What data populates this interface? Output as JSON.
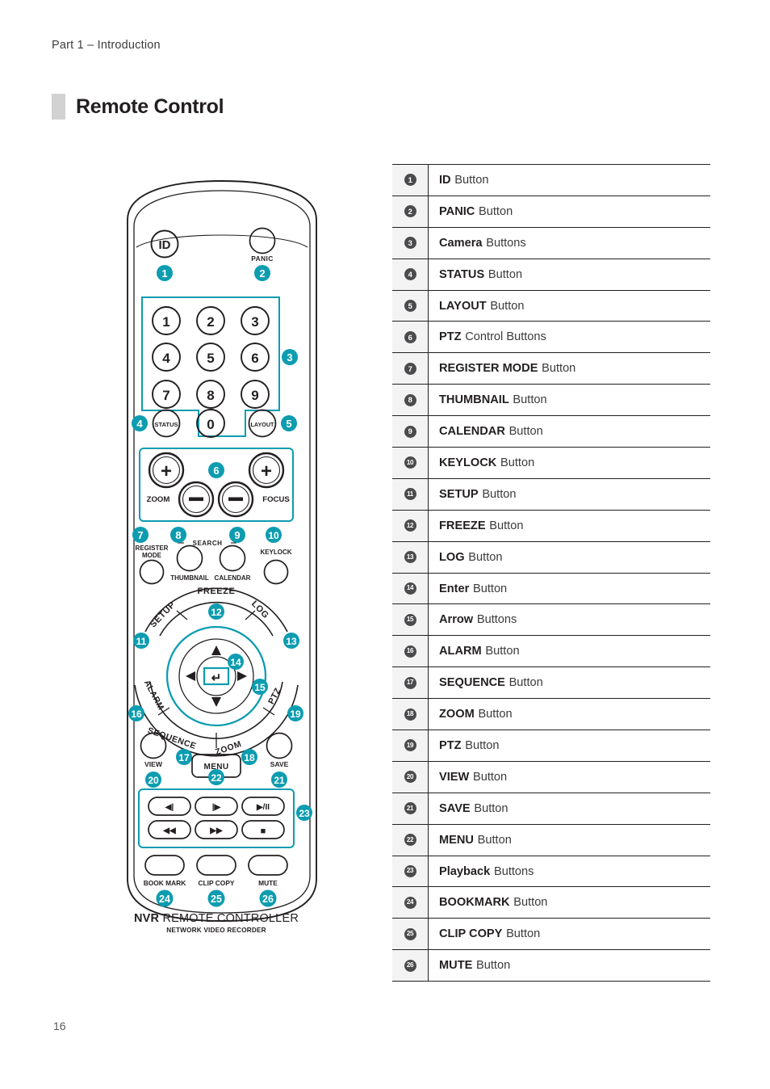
{
  "page": {
    "running_head": "Part 1 – Introduction",
    "section_title": "Remote Control",
    "page_number": "16"
  },
  "colors": {
    "accent_teal": "#0d9cb0",
    "badge_dark": "#4b4b4d",
    "marker_gray": "#d2d2d2",
    "row_num_bg": "#f3f3f3",
    "ink": "#231f20"
  },
  "reference_table": {
    "rows": [
      {
        "num": "1",
        "glyph": "❶",
        "bold": "ID",
        "rest": "Button"
      },
      {
        "num": "2",
        "glyph": "❷",
        "bold": "PANIC",
        "rest": "Button"
      },
      {
        "num": "3",
        "glyph": "❸",
        "bold": "Camera",
        "rest": "Buttons"
      },
      {
        "num": "4",
        "glyph": "❹",
        "bold": "STATUS",
        "rest": "Button"
      },
      {
        "num": "5",
        "glyph": "❺",
        "bold": "LAYOUT",
        "rest": "Button"
      },
      {
        "num": "6",
        "glyph": "❻",
        "bold": "PTZ",
        "rest": "Control Buttons"
      },
      {
        "num": "7",
        "glyph": "❼",
        "bold": "REGISTER MODE",
        "rest": "Button"
      },
      {
        "num": "8",
        "glyph": "❽",
        "bold": "THUMBNAIL",
        "rest": "Button"
      },
      {
        "num": "9",
        "glyph": "❾",
        "bold": "CALENDAR",
        "rest": "Button"
      },
      {
        "num": "10",
        "glyph": "❿",
        "bold": "KEYLOCK",
        "rest": "Button"
      },
      {
        "num": "11",
        "glyph": "⓫",
        "bold": "SETUP",
        "rest": "Button"
      },
      {
        "num": "12",
        "glyph": "⓬",
        "bold": "FREEZE",
        "rest": "Button"
      },
      {
        "num": "13",
        "glyph": "⓭",
        "bold": "LOG",
        "rest": "Button"
      },
      {
        "num": "14",
        "glyph": "⓮",
        "bold": "Enter",
        "rest": "Button"
      },
      {
        "num": "15",
        "glyph": "⓯",
        "bold": "Arrow",
        "rest": "Buttons"
      },
      {
        "num": "16",
        "glyph": "⓰",
        "bold": "ALARM",
        "rest": "Button"
      },
      {
        "num": "17",
        "glyph": "⓱",
        "bold": "SEQUENCE",
        "rest": "Button"
      },
      {
        "num": "18",
        "glyph": "⓲",
        "bold": "ZOOM",
        "rest": "Button"
      },
      {
        "num": "19",
        "glyph": "⓳",
        "bold": "PTZ",
        "rest": "Button"
      },
      {
        "num": "20",
        "glyph": "⓴",
        "bold": "VIEW",
        "rest": "Button"
      },
      {
        "num": "21",
        "glyph": "㉑",
        "bold": "SAVE",
        "rest": "Button"
      },
      {
        "num": "22",
        "glyph": "㉒",
        "bold": "MENU",
        "rest": "Button"
      },
      {
        "num": "23",
        "glyph": "㉓",
        "bold": "Playback",
        "rest": "Buttons"
      },
      {
        "num": "24",
        "glyph": "㉔",
        "bold": "BOOKMARK",
        "rest": "Button"
      },
      {
        "num": "25",
        "glyph": "㉕",
        "bold": "CLIP COPY",
        "rest": "Button"
      },
      {
        "num": "26",
        "glyph": "㉖",
        "bold": "MUTE",
        "rest": "Button"
      }
    ]
  },
  "remote": {
    "brand_line_bold": "NVR",
    "brand_line_rest": "REMOTE CONTROLLER",
    "brand_sub": "NETWORK VIDEO  RECORDER",
    "buttons": {
      "id": "ID",
      "panic": "PANIC",
      "keypad": [
        "1",
        "2",
        "3",
        "4",
        "5",
        "6",
        "7",
        "8",
        "9",
        "0"
      ],
      "status": "STATUS",
      "layout": "LAYOUT",
      "zoom": "ZOOM",
      "focus": "FOCUS",
      "plus": "+",
      "minus": "−",
      "register_mode_l1": "REGISTER",
      "register_mode_l2": "MODE",
      "search": "SEARCH",
      "thumbnail": "THUMBNAIL",
      "calendar": "CALENDAR",
      "keylock": "KEYLOCK",
      "setup": "SETUP",
      "freeze": "FREEZE",
      "log": "LOG",
      "alarm": "ALARM",
      "sequence": "SEQUENCE",
      "ring_zoom": "ZOOM",
      "ptz": "PTZ",
      "view": "VIEW",
      "menu": "MENU",
      "save": "SAVE",
      "book_mark": "BOOK MARK",
      "clip_copy": "CLIP COPY",
      "mute": "MUTE",
      "enter_glyph": "↵",
      "arrow_up": "▲",
      "arrow_down": "▼",
      "arrow_left": "◀",
      "arrow_right": "▶",
      "step_back": "◀|",
      "step_fwd": "|▶",
      "play_pause": "▶/II",
      "rewind": "◀◀",
      "fast_fwd": "▶▶",
      "stop": "■"
    },
    "callouts": [
      "1",
      "2",
      "3",
      "4",
      "5",
      "6",
      "7",
      "8",
      "9",
      "10",
      "11",
      "12",
      "13",
      "14",
      "15",
      "16",
      "17",
      "18",
      "19",
      "20",
      "21",
      "22",
      "23",
      "24",
      "25",
      "26"
    ]
  }
}
